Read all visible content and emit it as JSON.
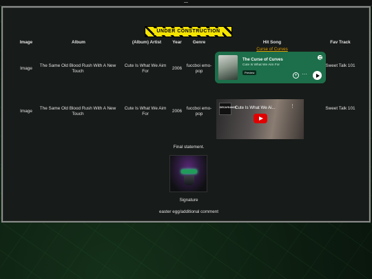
{
  "banner": {
    "text": "UNDER CONSTRUCTION"
  },
  "table": {
    "headers": [
      "Image",
      "Album",
      "(Album) Artist",
      "Year",
      "Genre",
      "Hit Song",
      "Fav Track"
    ],
    "rows": [
      {
        "image": "Image",
        "album": "The Same Old Blood Rush With A New Touch",
        "artist": "Cute Is What We Aim For",
        "year": "2006",
        "genre": "fuccboi emo-pop",
        "hit_song_link": "Curse of Curves",
        "fav_track": "Sweet Talk 101"
      },
      {
        "image": "Image",
        "album": "The Same Old Blood Rush With A New Touch",
        "artist": "Cute Is What We Aim For",
        "year": "2006",
        "genre": "fuccboi emo-pop",
        "fav_track": "Sweet Talk 101"
      }
    ]
  },
  "spotify_embed": {
    "title": "The Curse of Curves",
    "artist": "Cute Is What We Aim For",
    "badge": "Preview",
    "more": "···",
    "icons": [
      "album-art",
      "spotify-logo-icon",
      "add-icon",
      "more-icon",
      "play-icon"
    ],
    "accent": "#1d6e4a"
  },
  "youtube_embed": {
    "channel_badge": "DECAYDANCE",
    "title": "Cute Is What We Ai...",
    "menu": "⋮",
    "icons": [
      "channel-icon",
      "more-vertical-icon",
      "play-icon"
    ],
    "accent": "#e00000"
  },
  "footer": {
    "final_statement": "Final statement.",
    "signature": "Signature",
    "easter_egg": "easter egg/additional comment"
  }
}
